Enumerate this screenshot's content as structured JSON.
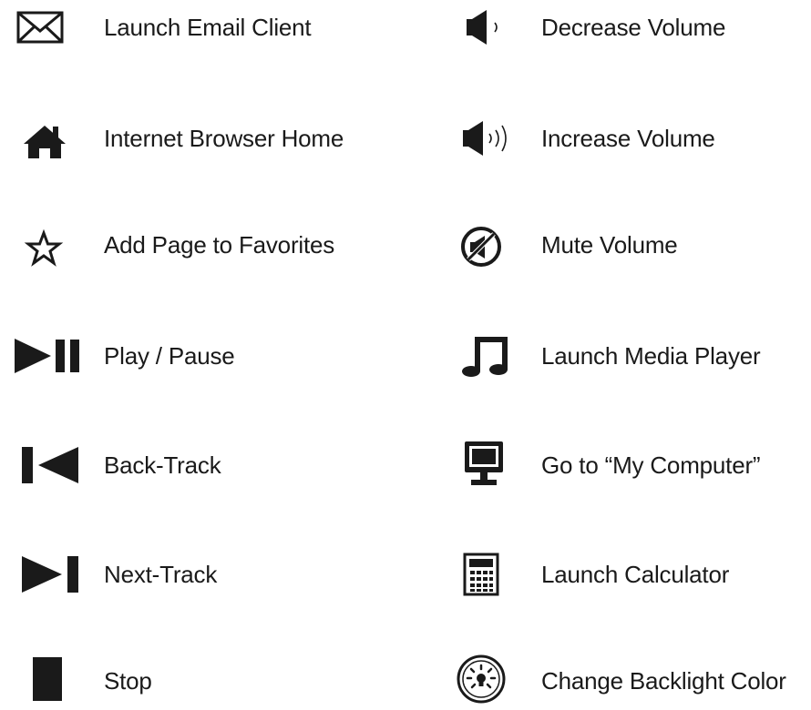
{
  "legend": {
    "left_column": [
      {
        "label": "Launch Email Client",
        "icon": "email-icon"
      },
      {
        "label": "Internet Browser Home",
        "icon": "home-icon"
      },
      {
        "label": "Add Page to Favorites",
        "icon": "star-icon"
      },
      {
        "label": "Play / Pause",
        "icon": "play-pause-icon"
      },
      {
        "label": "Back-Track",
        "icon": "previous-track-icon"
      },
      {
        "label": "Next-Track",
        "icon": "next-track-icon"
      },
      {
        "label": "Stop",
        "icon": "stop-icon"
      }
    ],
    "right_column": [
      {
        "label": "Decrease Volume",
        "icon": "volume-down-icon"
      },
      {
        "label": "Increase Volume",
        "icon": "volume-up-icon"
      },
      {
        "label": "Mute Volume",
        "icon": "mute-icon"
      },
      {
        "label": "Launch Media Player",
        "icon": "music-note-icon"
      },
      {
        "label": "Go to “My Computer”",
        "icon": "computer-monitor-icon"
      },
      {
        "label": "Launch Calculator",
        "icon": "calculator-icon"
      },
      {
        "label": "Change Backlight Color",
        "icon": "backlight-icon"
      }
    ]
  },
  "colors": {
    "icon": "#1a1a1a",
    "text": "#1a1a1a",
    "background": "#ffffff"
  }
}
